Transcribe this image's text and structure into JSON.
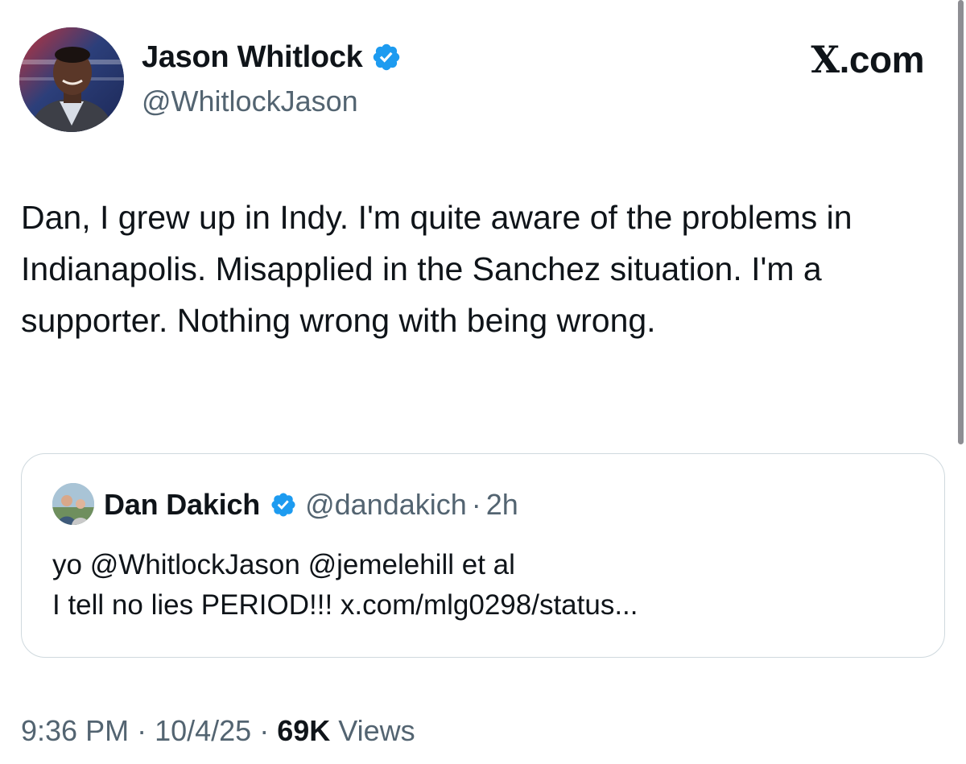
{
  "author": {
    "display_name": "Jason Whitlock",
    "handle": "@WhitlockJason",
    "verified_icon": "verified-badge-icon"
  },
  "brand": {
    "glyph": "X",
    "suffix": ".com"
  },
  "tweet": {
    "text": "Dan, I grew up in Indy. I'm quite aware of the problems in Indianapolis. Misapplied in the Sanchez situation. I'm a supporter. Nothing wrong with being wrong."
  },
  "quoted_tweet": {
    "display_name": "Dan Dakich",
    "handle": "@dandakich",
    "separator": "·",
    "time": "2h",
    "line1": "yo @WhitlockJason @jemelehill et al",
    "line2": "I tell no lies PERIOD!!! x.com/mlg0298/status..."
  },
  "meta": {
    "time": "9:36 PM",
    "sep1": " · ",
    "date": "10/4/25",
    "sep2": " · ",
    "views_count": "69K",
    "views_label": " Views"
  },
  "colors": {
    "primary_text": "#0f1419",
    "secondary_text": "#536471",
    "verified_blue": "#1d9bf0",
    "border": "#cfd9de"
  }
}
